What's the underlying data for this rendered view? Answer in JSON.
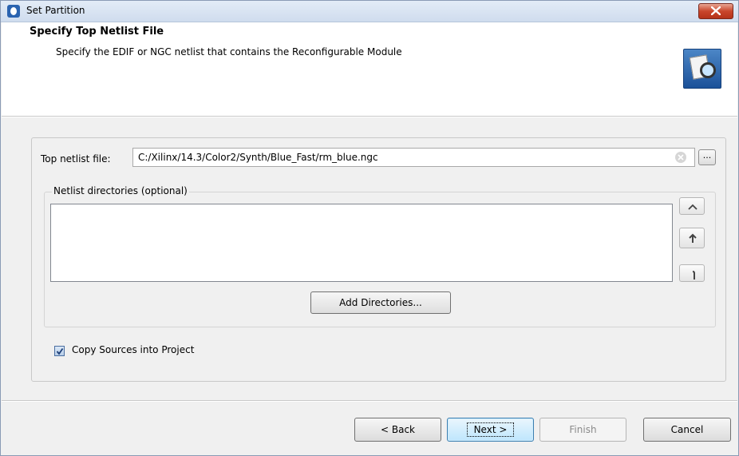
{
  "window": {
    "title": "Set Partition"
  },
  "header": {
    "title": "Specify Top Netlist File",
    "description": "Specify the EDIF or NGC netlist that contains the Reconfigurable Module"
  },
  "form": {
    "top_netlist_label": "Top netlist file:",
    "top_netlist_value": "C:/Xilinx/14.3/Color2/Synth/Blue_Fast/rm_blue.ngc",
    "browse_label": "...",
    "netlist_dirs_label": "Netlist directories (optional)",
    "add_directories_label": "Add Directories...",
    "copy_sources_label": "Copy Sources into Project",
    "copy_sources_checked": true
  },
  "buttons": {
    "back": "< Back",
    "next": "Next >",
    "finish": "Finish",
    "cancel": "Cancel"
  },
  "icons": [
    "app-icon",
    "close-icon",
    "wizard-icon",
    "clear-icon",
    "up-arrow-icon",
    "move-up-icon",
    "move-down-icon",
    "checkmark-icon"
  ]
}
